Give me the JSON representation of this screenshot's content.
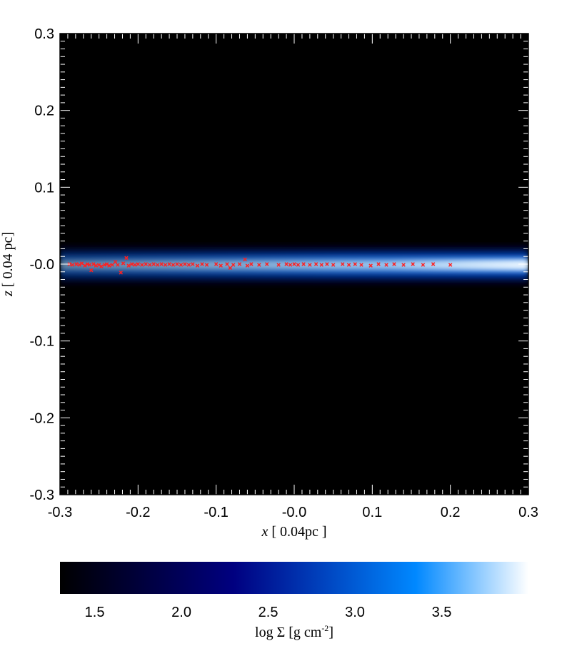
{
  "chart_data": [
    {
      "type": "heatmap",
      "title": "",
      "xlabel_var": "x",
      "xlabel_unit": " [ 0.04pc ]",
      "ylabel_var": "z",
      "ylabel_unit": " [ 0.04 pc]",
      "xlim": [
        -0.3,
        0.3
      ],
      "ylim": [
        -0.3,
        0.3
      ],
      "x_ticks": [
        "-0.3",
        "-0.2",
        "-0.1",
        "-0.0",
        "0.1",
        "0.2",
        "0.3"
      ],
      "y_ticks": [
        "-0.3",
        "-0.2",
        "-0.1",
        "-0.0",
        "0.1",
        "0.2",
        "0.3"
      ],
      "x_tick_values": [
        -0.3,
        -0.2,
        -0.1,
        0.0,
        0.1,
        0.2,
        0.3
      ],
      "y_tick_values": [
        -0.3,
        -0.2,
        -0.1,
        0.0,
        0.1,
        0.2,
        0.3
      ],
      "background_color": "#000000",
      "disk": {
        "center_z": -0.001,
        "core_half_thickness": 0.006,
        "halo_half_thickness": 0.03,
        "color_core": "#ffffff",
        "color_mid": "#1a8cff",
        "color_outer": "#002080"
      },
      "markers": {
        "symbol": "x",
        "color": "#ff2020",
        "points": [
          [
            -0.288,
            0.0
          ],
          [
            -0.284,
            -0.001
          ],
          [
            -0.279,
            0.0
          ],
          [
            -0.275,
            -0.001
          ],
          [
            -0.272,
            0.001
          ],
          [
            -0.268,
            -0.002
          ],
          [
            -0.265,
            0.0
          ],
          [
            -0.262,
            -0.001
          ],
          [
            -0.26,
            -0.008
          ],
          [
            -0.257,
            0.0
          ],
          [
            -0.254,
            -0.002
          ],
          [
            -0.25,
            -0.001
          ],
          [
            -0.247,
            -0.003
          ],
          [
            -0.243,
            -0.001
          ],
          [
            -0.24,
            0.0
          ],
          [
            -0.237,
            -0.002
          ],
          [
            -0.233,
            -0.001
          ],
          [
            -0.229,
            0.003
          ],
          [
            -0.226,
            -0.001
          ],
          [
            -0.222,
            -0.011
          ],
          [
            -0.219,
            0.001
          ],
          [
            -0.215,
            0.008
          ],
          [
            -0.212,
            -0.002
          ],
          [
            -0.208,
            0.0
          ],
          [
            -0.204,
            -0.001
          ],
          [
            -0.2,
            0.0
          ],
          [
            -0.195,
            -0.001
          ],
          [
            -0.19,
            0.0
          ],
          [
            -0.185,
            -0.001
          ],
          [
            -0.18,
            0.0
          ],
          [
            -0.175,
            -0.001
          ],
          [
            -0.17,
            0.0
          ],
          [
            -0.165,
            -0.001
          ],
          [
            -0.16,
            0.0
          ],
          [
            -0.155,
            -0.001
          ],
          [
            -0.15,
            0.0
          ],
          [
            -0.145,
            -0.001
          ],
          [
            -0.14,
            0.0
          ],
          [
            -0.135,
            -0.001
          ],
          [
            -0.13,
            0.0
          ],
          [
            -0.124,
            -0.002
          ],
          [
            -0.118,
            0.0
          ],
          [
            -0.112,
            -0.001
          ],
          [
            -0.1,
            0.0
          ],
          [
            -0.094,
            -0.002
          ],
          [
            -0.086,
            0.0
          ],
          [
            -0.082,
            -0.005
          ],
          [
            -0.078,
            -0.001
          ],
          [
            -0.07,
            0.0
          ],
          [
            -0.063,
            0.006
          ],
          [
            -0.06,
            -0.002
          ],
          [
            -0.055,
            0.0
          ],
          [
            -0.045,
            -0.001
          ],
          [
            -0.035,
            0.0
          ],
          [
            -0.02,
            -0.001
          ],
          [
            -0.01,
            0.0
          ],
          [
            -0.005,
            -0.001
          ],
          [
            0.0,
            0.0
          ],
          [
            0.005,
            -0.001
          ],
          [
            0.012,
            0.0
          ],
          [
            0.02,
            -0.001
          ],
          [
            0.028,
            0.0
          ],
          [
            0.035,
            -0.001
          ],
          [
            0.042,
            0.0
          ],
          [
            0.05,
            -0.001
          ],
          [
            0.062,
            0.0
          ],
          [
            0.07,
            -0.001
          ],
          [
            0.078,
            0.0
          ],
          [
            0.086,
            -0.001
          ],
          [
            0.098,
            -0.002
          ],
          [
            0.108,
            0.0
          ],
          [
            0.118,
            -0.001
          ],
          [
            0.128,
            0.0
          ],
          [
            0.14,
            -0.001
          ],
          [
            0.152,
            0.0
          ],
          [
            0.165,
            -0.001
          ],
          [
            0.178,
            0.0
          ],
          [
            0.2,
            -0.001
          ]
        ]
      }
    },
    {
      "type": "colorbar",
      "label_prefix": "log ",
      "label_symbol": "Σ",
      "label_unit": " [g cm",
      "label_exp": "-2",
      "label_close": "]",
      "range": [
        1.3,
        4.0
      ],
      "ticks": [
        "1.5",
        "2.0",
        "2.5",
        "3.0",
        "3.5"
      ],
      "tick_values": [
        1.5,
        2.0,
        2.5,
        3.0,
        3.5
      ],
      "stops": [
        {
          "value": 1.3,
          "color": "#000000"
        },
        {
          "value": 2.3,
          "color": "#000080"
        },
        {
          "value": 3.35,
          "color": "#0088ff"
        },
        {
          "value": 4.0,
          "color": "#ffffff"
        }
      ]
    }
  ]
}
